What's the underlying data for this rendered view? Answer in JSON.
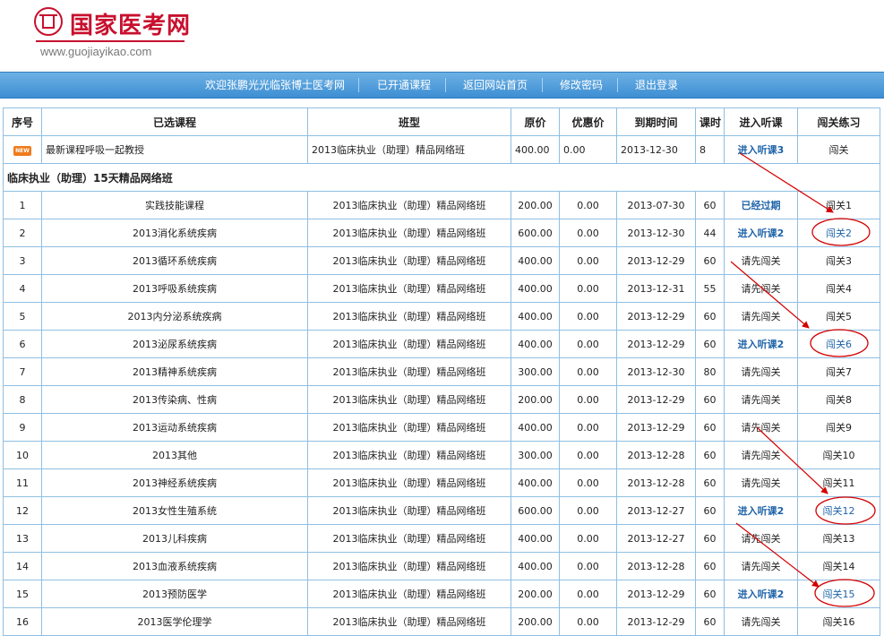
{
  "header": {
    "site_name": "国家医考网",
    "site_url": "www.guojiayikao.com"
  },
  "nav": {
    "items": [
      {
        "label": "欢迎张鹏光光临张博士医考网"
      },
      {
        "label": "已开通课程"
      },
      {
        "label": "返回网站首页"
      },
      {
        "label": "修改密码"
      },
      {
        "label": "退出登录"
      }
    ]
  },
  "table": {
    "headers": [
      "序号",
      "已选课程",
      "班型",
      "原价",
      "优惠价",
      "到期时间",
      "课时",
      "进入听课",
      "闯关练习"
    ],
    "featured_row": {
      "badge": "NEW",
      "course": "最新课程呼吸一起教授",
      "class": "2013临床执业（助理）精品网络班",
      "price": "400.00",
      "discount": "0.00",
      "expire": "2013-12-30",
      "hours": "8",
      "action": "进入听课3",
      "practice": "闯关"
    },
    "group_title": "临床执业（助理）15天精品网络班",
    "rows": [
      {
        "no": "1",
        "course": "实践技能课程",
        "class": "2013临床执业（助理）精品网络班",
        "price": "200.00",
        "discount": "0.00",
        "expire": "2013-07-30",
        "hours": "60",
        "action": "已经过期",
        "practice": "闯关1"
      },
      {
        "no": "2",
        "course": "2013消化系统疾病",
        "class": "2013临床执业（助理）精品网络班",
        "price": "600.00",
        "discount": "0.00",
        "expire": "2013-12-30",
        "hours": "44",
        "action": "进入听课2",
        "practice": "闯关2"
      },
      {
        "no": "3",
        "course": "2013循环系统疾病",
        "class": "2013临床执业（助理）精品网络班",
        "price": "400.00",
        "discount": "0.00",
        "expire": "2013-12-29",
        "hours": "60",
        "action": "请先闯关",
        "practice": "闯关3"
      },
      {
        "no": "4",
        "course": "2013呼吸系统疾病",
        "class": "2013临床执业（助理）精品网络班",
        "price": "400.00",
        "discount": "0.00",
        "expire": "2013-12-31",
        "hours": "55",
        "action": "请先闯关",
        "practice": "闯关4"
      },
      {
        "no": "5",
        "course": "2013内分泌系统疾病",
        "class": "2013临床执业（助理）精品网络班",
        "price": "400.00",
        "discount": "0.00",
        "expire": "2013-12-29",
        "hours": "60",
        "action": "请先闯关",
        "practice": "闯关5"
      },
      {
        "no": "6",
        "course": "2013泌尿系统疾病",
        "class": "2013临床执业（助理）精品网络班",
        "price": "400.00",
        "discount": "0.00",
        "expire": "2013-12-29",
        "hours": "60",
        "action": "进入听课2",
        "practice": "闯关6"
      },
      {
        "no": "7",
        "course": "2013精神系统疾病",
        "class": "2013临床执业（助理）精品网络班",
        "price": "300.00",
        "discount": "0.00",
        "expire": "2013-12-30",
        "hours": "80",
        "action": "请先闯关",
        "practice": "闯关7"
      },
      {
        "no": "8",
        "course": "2013传染病、性病",
        "class": "2013临床执业（助理）精品网络班",
        "price": "200.00",
        "discount": "0.00",
        "expire": "2013-12-29",
        "hours": "60",
        "action": "请先闯关",
        "practice": "闯关8"
      },
      {
        "no": "9",
        "course": "2013运动系统疾病",
        "class": "2013临床执业（助理）精品网络班",
        "price": "400.00",
        "discount": "0.00",
        "expire": "2013-12-29",
        "hours": "60",
        "action": "请先闯关",
        "practice": "闯关9"
      },
      {
        "no": "10",
        "course": "2013其他",
        "class": "2013临床执业（助理）精品网络班",
        "price": "300.00",
        "discount": "0.00",
        "expire": "2013-12-28",
        "hours": "60",
        "action": "请先闯关",
        "practice": "闯关10"
      },
      {
        "no": "11",
        "course": "2013神经系统疾病",
        "class": "2013临床执业（助理）精品网络班",
        "price": "400.00",
        "discount": "0.00",
        "expire": "2013-12-28",
        "hours": "60",
        "action": "请先闯关",
        "practice": "闯关11"
      },
      {
        "no": "12",
        "course": "2013女性生殖系统",
        "class": "2013临床执业（助理）精品网络班",
        "price": "600.00",
        "discount": "0.00",
        "expire": "2013-12-27",
        "hours": "60",
        "action": "进入听课2",
        "practice": "闯关12"
      },
      {
        "no": "13",
        "course": "2013儿科疾病",
        "class": "2013临床执业（助理）精品网络班",
        "price": "400.00",
        "discount": "0.00",
        "expire": "2013-12-27",
        "hours": "60",
        "action": "请先闯关",
        "practice": "闯关13"
      },
      {
        "no": "14",
        "course": "2013血液系统疾病",
        "class": "2013临床执业（助理）精品网络班",
        "price": "400.00",
        "discount": "0.00",
        "expire": "2013-12-28",
        "hours": "60",
        "action": "请先闯关",
        "practice": "闯关14"
      },
      {
        "no": "15",
        "course": "2013预防医学",
        "class": "2013临床执业（助理）精品网络班",
        "price": "200.00",
        "discount": "0.00",
        "expire": "2013-12-29",
        "hours": "60",
        "action": "进入听课2",
        "practice": "闯关15"
      },
      {
        "no": "16",
        "course": "2013医学伦理学",
        "class": "2013临床执业（助理）精品网络班",
        "price": "200.00",
        "discount": "0.00",
        "expire": "2013-12-29",
        "hours": "60",
        "action": "请先闯关",
        "practice": "闯关16"
      }
    ]
  },
  "colors": {
    "brand_red": "#c8102e",
    "nav_blue": "#3d8ed3",
    "link_blue": "#1e63a8",
    "border_blue": "#8fbfe3",
    "annotation_red": "#d40000"
  }
}
